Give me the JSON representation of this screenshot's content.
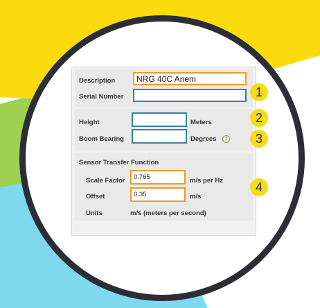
{
  "colors": {
    "yellow": "#fbdb0b",
    "green": "#9fd04f",
    "cyan": "#7fd9ee",
    "ring": "#2d2d35",
    "input_orange": "#f39a1e",
    "input_teal": "#3d7f9a",
    "badge": "#f7dc1d"
  },
  "form": {
    "description": {
      "label": "Description",
      "value": "NRG 40C Anem"
    },
    "serial_number": {
      "label": "Serial Number",
      "value": ""
    },
    "height": {
      "label": "Height",
      "value": "",
      "unit": "Meters"
    },
    "boom_bearing": {
      "label": "Boom Bearing",
      "value": "",
      "unit": "Degrees",
      "info_icon": "info-icon"
    },
    "transfer": {
      "heading": "Sensor Transfer Function",
      "scale_factor": {
        "label": "Scale Factor",
        "value": "0.765",
        "unit": "m/s per Hz"
      },
      "offset": {
        "label": "Offset",
        "value": "0.35",
        "unit": "m/s"
      },
      "units": {
        "label": "Units",
        "value": "m/s (meters per second)"
      }
    }
  },
  "badges": [
    "1",
    "2",
    "3",
    "4"
  ]
}
